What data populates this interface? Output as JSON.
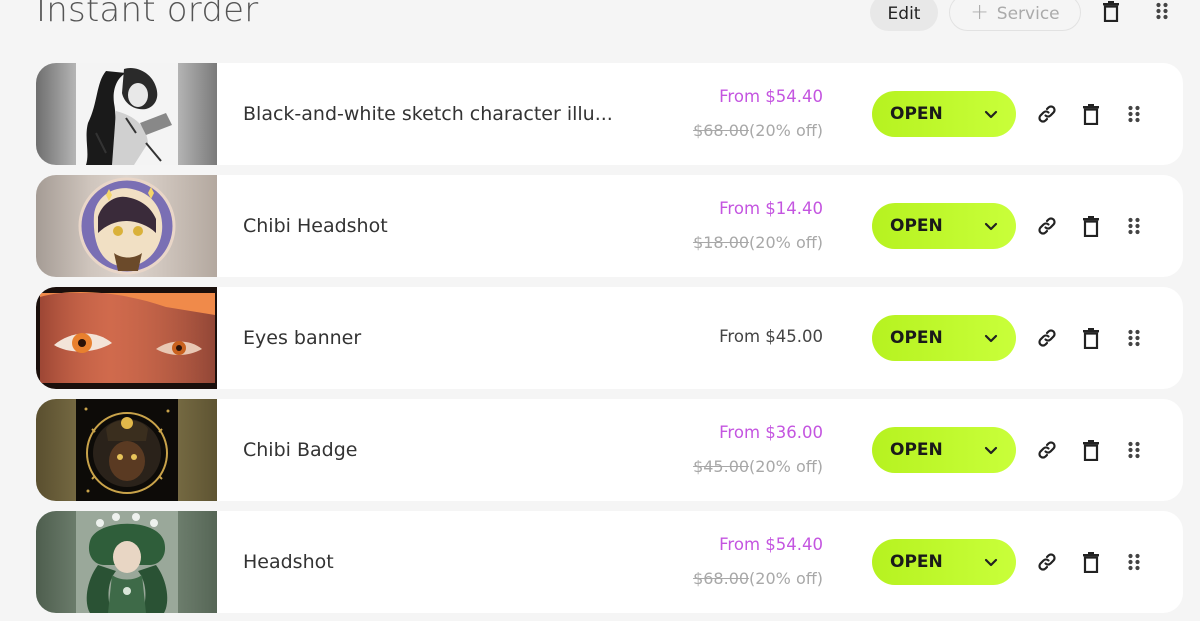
{
  "header": {
    "title": "Instant order",
    "edit_label": "Edit",
    "add_service_label": "Service",
    "add_icon": "plus-icon",
    "trash_icon": "trash-icon",
    "drag_icon": "drag-handle-icon"
  },
  "colors": {
    "accent_price": "#c455e0",
    "status_button": "#c2fb2f",
    "background": "#f5f5f5"
  },
  "items": [
    {
      "title": "Black-and-white sketch character illu...",
      "price": "From $54.40",
      "original_price": "$68.00",
      "discount": "(20% off)",
      "status": "OPEN"
    },
    {
      "title": "Chibi Headshot",
      "price": "From $14.40",
      "original_price": "$18.00",
      "discount": "(20% off)",
      "status": "OPEN"
    },
    {
      "title": "Eyes banner",
      "price": "From $45.00",
      "status": "OPEN"
    },
    {
      "title": "Chibi Badge",
      "price": "From $36.00",
      "original_price": "$45.00",
      "discount": "(20% off)",
      "status": "OPEN"
    },
    {
      "title": "Headshot",
      "price": "From $54.40",
      "original_price": "$68.00",
      "discount": "(20% off)",
      "status": "OPEN"
    }
  ]
}
